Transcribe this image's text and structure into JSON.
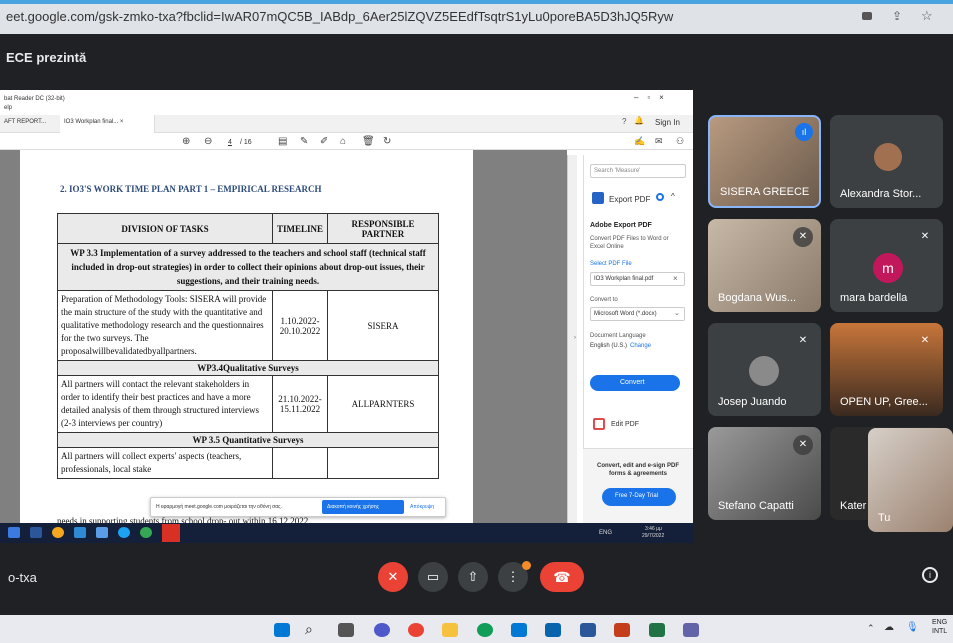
{
  "browser": {
    "url": "eet.google.com/gsk-zmko-txa?fbclid=IwAR07mQC5B_IABdp_6Aer25lZQVZ5EEdfTsqtrS1yLu0poreBA5D3hJQ5Ryw",
    "tab_title": "ECE prezintă"
  },
  "reader": {
    "window_title": "bat Reader DC (32-bit)",
    "menu": "elp",
    "tabs": [
      "AFT REPORT...",
      "IO3 Workplan final...  ×"
    ],
    "page_current": "4",
    "page_total": "/ 16",
    "help": "?",
    "sign_in": "Sign In"
  },
  "doc": {
    "heading": "2.  IO3'S WORK TIME PLAN PART 1 – EMPIRICAL RESEARCH",
    "col_division": "DIVISION OF TASKS",
    "col_timeline": "TIMELINE",
    "col_responsible": "RESPONSIBLE PARTNER",
    "wp33": "WP 3.3 Implementation of a survey addressed to the teachers and school staff (technical staff included in drop-out strategies) in order to collect their opinions about drop-out issues, their suggestions, and their training needs.",
    "prep_task": "Preparation of Methodology Tools: SISERA will provide the main structure of the study with the quantitative and qualitative methodology research and the questionnaires for the two surveys. The proposalwillbevalidatedbyallpartners.",
    "prep_time": "1.10.2022-20.10.2022",
    "prep_partner": "SISERA",
    "wp34": "WP3.4Qualitative Surveys",
    "qual_task": "All partners will contact the relevant stakeholders in order to identify their best practices and have a more detailed analysis of them through structured interviews (2-3 interviews per country)",
    "qual_time": "21.10.2022-15.11.2022",
    "qual_partner": "ALLPARNTERS",
    "wp35": "WP 3.5 Quantitative Surveys",
    "quan_task": "All partners will collect experts' aspects (teachers, professionals, local stake",
    "quan_partial": "needs in supporting students from school drop- out within 16.12.2022"
  },
  "side": {
    "search_placeholder": "Search 'Measure'",
    "export_pdf": "Export PDF",
    "adobe_export": "Adobe Export PDF",
    "convert_desc": "Convert PDF Files to Word or Excel Online",
    "select_file": "Select PDF File",
    "file_name": "IO3 Workplan final.pdf",
    "convert_to": "Convert to",
    "format": "Microsoft Word (*.docx)",
    "doc_lang": "Document Language",
    "lang": "English (U.S.)",
    "change": "Change",
    "convert_btn": "Convert",
    "edit_pdf": "Edit PDF",
    "promo": "Convert, edit and e-sign PDF forms & agreements",
    "trial_btn": "Free 7-Day Trial"
  },
  "share_bar": {
    "text": "Η εφαρμογή meet.google.com μοιράζεται την οθόνη σας.",
    "stop": "Διακοπή κοινής χρήσης",
    "hide": "Απόκρυψη"
  },
  "inner_taskbar": {
    "lang": "ENG",
    "time": "3:46 μμ",
    "date": "29/7/2022"
  },
  "participants": [
    {
      "name": "SISERA GREECE"
    },
    {
      "name": "Alexandra Stor..."
    },
    {
      "name": "Bogdana Wus..."
    },
    {
      "name": "mara bardella",
      "initial": "m"
    },
    {
      "name": "Josep Juando"
    },
    {
      "name": "OPEN UP, Gree..."
    },
    {
      "name": "Stefano Capatti"
    },
    {
      "name": "Kater"
    },
    {
      "name": "Tu"
    }
  ],
  "meeting_code": "o-txa",
  "taskbar": {
    "lang": "ENG",
    "lang2": "INTL"
  },
  "colors": {
    "accent": "#1a73e8",
    "end_call": "#ea4335",
    "mute_red": "#ea4335"
  }
}
